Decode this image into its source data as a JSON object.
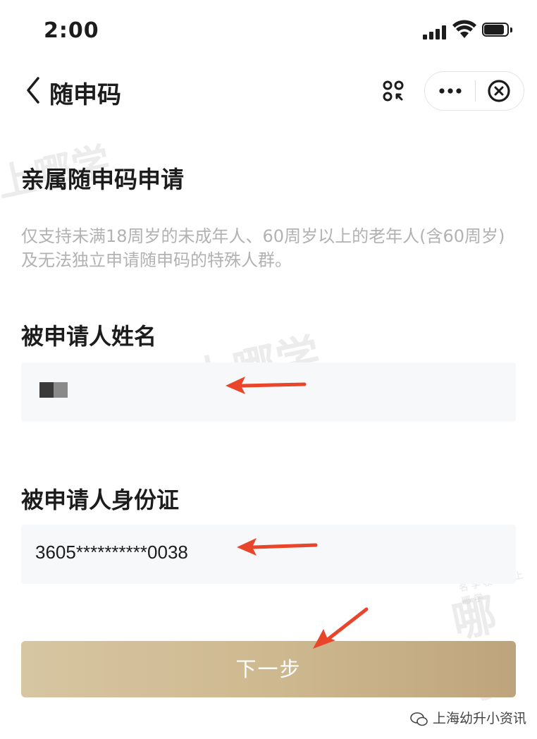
{
  "status_bar": {
    "time": "2:00",
    "icons": [
      "signal-icon",
      "wifi-icon",
      "battery-icon"
    ]
  },
  "nav": {
    "title": "随申码",
    "icons": [
      "back-chevron-icon",
      "scan-icon",
      "more-dots-icon",
      "close-circle-icon"
    ]
  },
  "form": {
    "section_title": "亲属随申码申请",
    "description": "仅支持未满18周岁的未成年人、60周岁以上的老年人(含60周岁)及无法独立申请随申码的特殊人群。",
    "name_label": "被申请人姓名",
    "name_value": "",
    "id_label": "被申请人身份证",
    "id_value": "3605**********0038",
    "next_button": "下一步"
  },
  "watermarks": {
    "logo_text": "上哪学",
    "sub_text": "名 学 校 · 问 上 哪 学"
  },
  "footer_mark": "上海幼升小资讯",
  "colors": {
    "button_gradient_start": "#d7c6a2",
    "button_gradient_end": "#bea47d",
    "field_background": "#f6f8f9",
    "description_text": "#b2b2b2",
    "arrow": "#e8452a"
  }
}
